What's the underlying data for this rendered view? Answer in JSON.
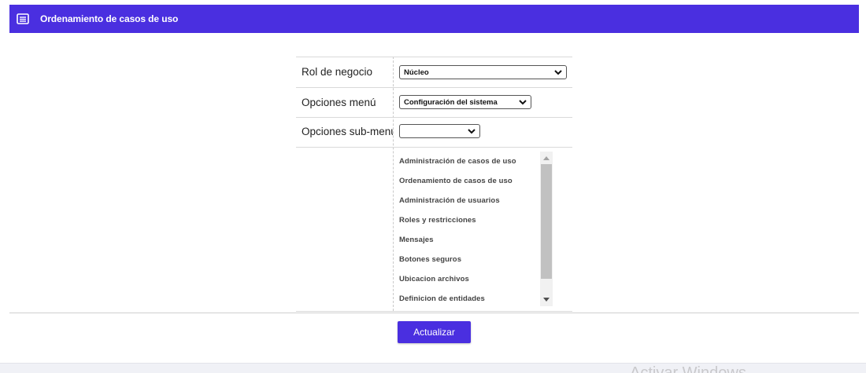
{
  "header": {
    "title": "Ordenamiento de casos de uso",
    "icon": "form-icon",
    "background": "#4a2fe0"
  },
  "form": {
    "rol_label": "Rol de negocio",
    "rol_value": "Núcleo",
    "menu_label": "Opciones menú",
    "menu_value": "Configuración del sistema",
    "submenu_label": "Opciones sub-menú",
    "submenu_value": ""
  },
  "use_cases": [
    "Administración de casos de uso",
    "Ordenamiento de casos de uso",
    "Administración de usuarios",
    "Roles y restricciones",
    "Mensajes",
    "Botones seguros",
    "Ubicacion archivos",
    "Definicion de entidades"
  ],
  "actions": {
    "update_label": "Actualizar"
  },
  "watermark": "Activar Windows"
}
